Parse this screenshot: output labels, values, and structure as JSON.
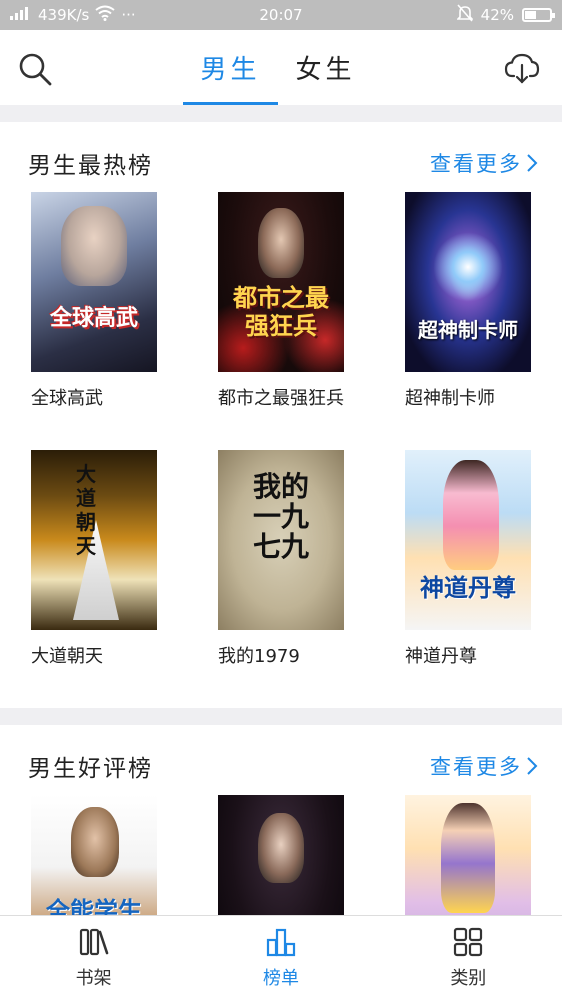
{
  "status_bar": {
    "network": "439K/s",
    "dots": "···",
    "time": "20:07",
    "battery": "42%",
    "battery_level": 0.42
  },
  "header": {
    "tabs": [
      {
        "label": "男生",
        "active": true
      },
      {
        "label": "女生",
        "active": false
      }
    ]
  },
  "sections": [
    {
      "title": "男生最热榜",
      "more_label": "查看更多",
      "books": [
        {
          "title": "全球高武",
          "cover_text": "全球高武"
        },
        {
          "title": "都市之最强狂兵",
          "cover_text": "都市之最强狂兵"
        },
        {
          "title": "超神制卡师",
          "cover_text": "超神制卡师"
        },
        {
          "title": "大道朝天",
          "cover_text": "大道朝天"
        },
        {
          "title": "我的1979",
          "cover_text": "我的一九七九"
        },
        {
          "title": "神道丹尊",
          "cover_text": "神道丹尊"
        }
      ]
    },
    {
      "title": "男生好评榜",
      "more_label": "查看更多",
      "books": [
        {
          "title": "",
          "cover_text": "全能学生"
        },
        {
          "title": "",
          "cover_text": ""
        },
        {
          "title": "",
          "cover_text": ""
        }
      ]
    }
  ],
  "bottom_nav": [
    {
      "label": "书架",
      "icon": "bookshelf-icon",
      "active": false
    },
    {
      "label": "榜单",
      "icon": "ranking-icon",
      "active": true
    },
    {
      "label": "类别",
      "icon": "category-icon",
      "active": false
    }
  ],
  "colors": {
    "accent": "#1e88e5",
    "divider": "#efeff2",
    "status_bar": "#bdbdbd"
  }
}
